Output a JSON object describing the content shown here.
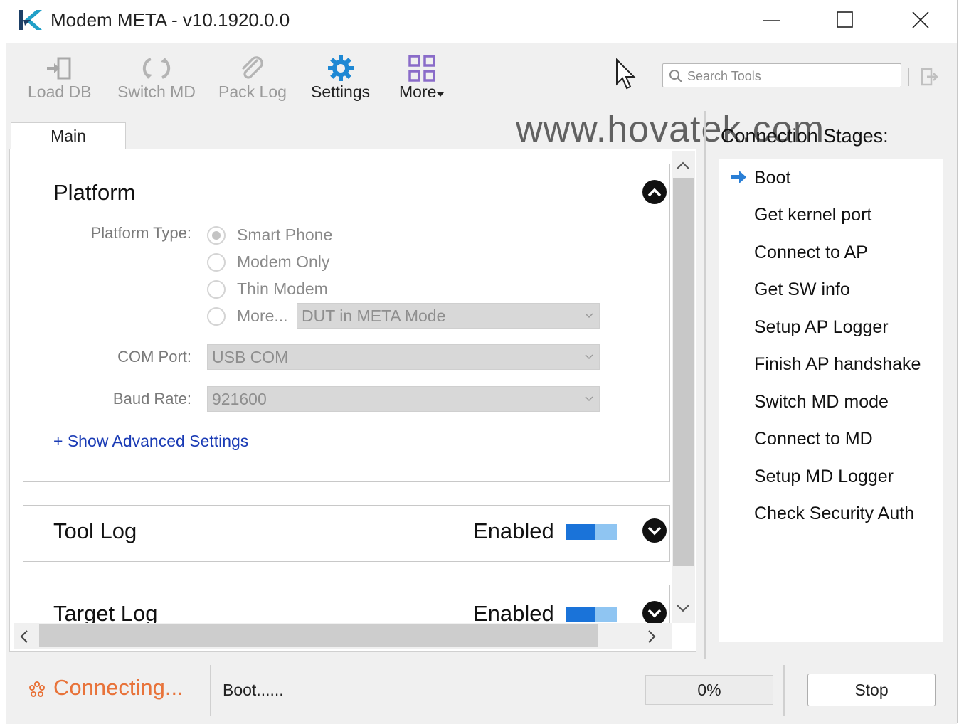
{
  "window": {
    "title": "Modem META - v10.1920.0.0",
    "icons": [
      "app-logo-icon",
      "minimize-icon",
      "maximize-icon",
      "close-icon"
    ]
  },
  "toolbar": {
    "items": [
      {
        "label": "Load DB",
        "icon": "load-db-icon",
        "enabled": false
      },
      {
        "label": "Switch MD",
        "icon": "switch-md-icon",
        "enabled": false
      },
      {
        "label": "Pack Log",
        "icon": "paperclip-icon",
        "enabled": false
      },
      {
        "label": "Settings",
        "icon": "gear-icon",
        "enabled": true
      },
      {
        "label": "More",
        "icon": "grid-icon",
        "enabled": true
      }
    ],
    "search_placeholder": "Search Tools"
  },
  "watermark": "www.hovatek.com",
  "tabs": [
    {
      "label": "Main",
      "active": true
    }
  ],
  "platform": {
    "title": "Platform",
    "type_label": "Platform Type:",
    "options": [
      {
        "label": "Smart Phone",
        "selected": true
      },
      {
        "label": "Modem Only",
        "selected": false
      },
      {
        "label": "Thin Modem",
        "selected": false
      },
      {
        "label": "More...",
        "selected": false
      }
    ],
    "more_mode": "DUT in META Mode",
    "com_port_label": "COM Port:",
    "com_port_value": "USB COM",
    "baud_rate_label": "Baud Rate:",
    "baud_rate_value": "921600",
    "advanced_link": "+ Show Advanced Settings"
  },
  "tool_log": {
    "title": "Tool Log",
    "status": "Enabled"
  },
  "target_log": {
    "title": "Target Log",
    "status": "Enabled"
  },
  "connection": {
    "title": "Connection Stages:",
    "current": 0,
    "stages": [
      "Boot",
      "Get kernel port",
      "Connect to AP",
      "Get SW info",
      "Setup AP Logger",
      "Finish AP handshake",
      "Switch MD mode",
      "Connect to MD",
      "Setup MD Logger",
      "Check Security Auth"
    ]
  },
  "status": {
    "state": "Connecting...",
    "message": "Boot......",
    "progress": "0%",
    "stop_label": "Stop"
  },
  "colors": {
    "accent": "#1a73d9",
    "toggle_track": "#8fc5f2",
    "connecting": "#e8733a",
    "link": "#1a3bb5",
    "settings_icon": "#1e88d4",
    "more_icon": "#8a6cc9"
  }
}
